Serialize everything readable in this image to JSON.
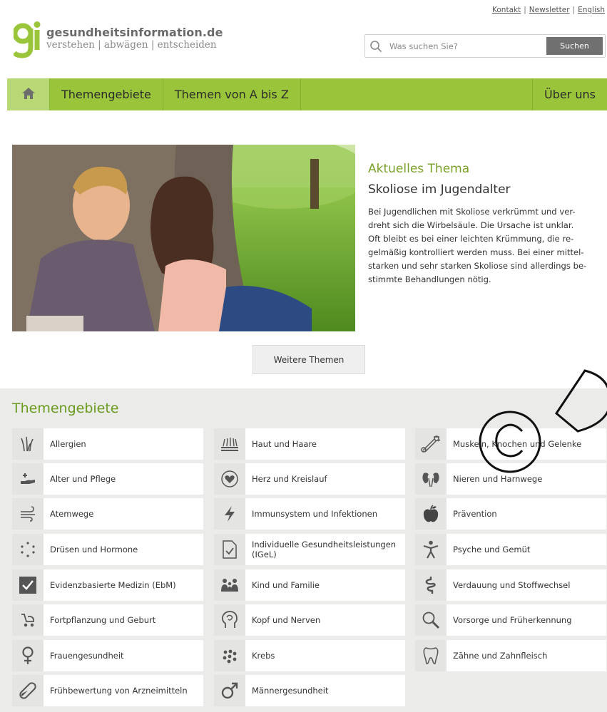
{
  "toplinks": [
    "Kontakt",
    "Newsletter",
    "English"
  ],
  "logo": {
    "mark": "gi",
    "title": "gesundheitsinformation.de",
    "tagline": "verstehen | abwägen | entscheiden"
  },
  "search": {
    "placeholder": "Was suchen Sie?",
    "button": "Suchen",
    "icon": "search-icon"
  },
  "nav": {
    "home_icon": "home-icon",
    "items": [
      "Themengebiete",
      "Themen von A bis Z"
    ],
    "right_item": "Über uns"
  },
  "hero": {
    "kicker": "Aktuelles Thema",
    "title": "Skoliose im Jugendalter",
    "body_lines": [
      "Bei Jugendlichen mit Skoliose verkrümmt und ver-",
      "dreht sich die Wirbelsäule. Die Ursache ist unklar.",
      "Oft bleibt es bei einer leichten Krümmung, die re-",
      "gelmäßig kontrolliert werden muss. Bei einer mittel-",
      "starken und sehr starken Skoliose sind allerdings be-",
      "stimmte Behandlungen nötig."
    ],
    "more_button": "Weitere Themen"
  },
  "topics": {
    "heading": "Themengebiete",
    "columns": [
      [
        {
          "label": "Allergien",
          "icon": "grass-icon"
        },
        {
          "label": "Alter und Pflege",
          "icon": "care-hand-icon"
        },
        {
          "label": "Atemwege",
          "icon": "wind-icon"
        },
        {
          "label": "Drüsen und Hormone",
          "icon": "dots-circle-icon"
        },
        {
          "label": "Evidenzbasierte Medizin (EbM)",
          "icon": "checkbox-icon"
        },
        {
          "label": "Fortpflanzung und Geburt",
          "icon": "stroller-icon"
        },
        {
          "label": "Frauengesundheit",
          "icon": "female-icon"
        },
        {
          "label": "Frühbewertung von Arzneimitteln",
          "icon": "pill-icon"
        }
      ],
      [
        {
          "label": "Haut und Haare",
          "icon": "skin-hair-icon"
        },
        {
          "label": "Herz und Kreislauf",
          "icon": "heart-icon"
        },
        {
          "label": "Immunsystem und Infektionen",
          "icon": "lightning-icon"
        },
        {
          "label": "Individuelle Gesundheitsleistungen (IGeL)",
          "icon": "document-check-icon"
        },
        {
          "label": "Kind und Familie",
          "icon": "family-icon"
        },
        {
          "label": "Kopf und Nerven",
          "icon": "head-icon"
        },
        {
          "label": "Krebs",
          "icon": "cells-icon"
        },
        {
          "label": "Männergesundheit",
          "icon": "male-icon"
        }
      ],
      [
        {
          "label": "Muskeln, Knochen und Gelenke",
          "icon": "bone-icon"
        },
        {
          "label": "Nieren und Harnwege",
          "icon": "kidney-icon"
        },
        {
          "label": "Prävention",
          "icon": "apple-icon"
        },
        {
          "label": "Psyche und Gemüt",
          "icon": "person-icon"
        },
        {
          "label": "Verdauung und Stoffwechsel",
          "icon": "intestine-icon"
        },
        {
          "label": "Vorsorge und Früherkennung",
          "icon": "magnifier-icon"
        },
        {
          "label": "Zähne und Zahnfleisch",
          "icon": "tooth-icon"
        }
      ]
    ]
  },
  "colors": {
    "brand_green": "#9ac53b",
    "heading_green": "#6a9a1e",
    "panel_bg": "#ebebea"
  }
}
